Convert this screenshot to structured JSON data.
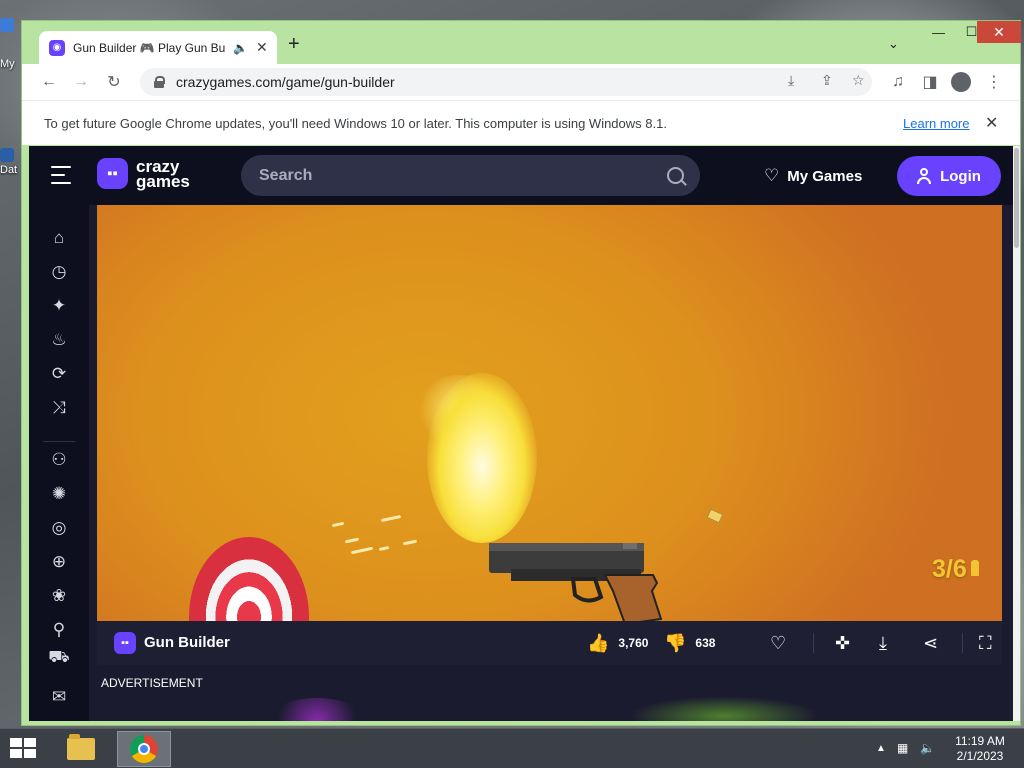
{
  "desktop": {
    "icons": [
      {
        "label": "My"
      },
      {
        "label": "Dat"
      }
    ]
  },
  "browser": {
    "tab": {
      "title": "Gun Builder 🎮 Play Gun Builder on CrazyGames",
      "favicon": "crazygames-logo-icon"
    },
    "new_tab_label": "+",
    "url": "crazygames.com/game/gun-builder",
    "info_bar": {
      "message": "To get future Google Chrome updates, you'll need Windows 10 or later. This computer is using Windows 8.1.",
      "link": "Learn more"
    }
  },
  "site": {
    "logo_text_line1": "crazy",
    "logo_text_line2": "games",
    "search_placeholder": "Search",
    "my_games": "My Games",
    "login": "Login",
    "sidebar_icons": [
      "home-icon",
      "recent-icon",
      "sparkle-icon",
      "fire-icon",
      "refresh-icon",
      "shuffle-icon",
      "multiplayer-icon",
      "action-icon",
      "compass-icon",
      "basketball-icon",
      "flower-icon",
      "bicycle-icon",
      "car-icon",
      "mail-icon"
    ],
    "brand_color": "#6842ff"
  },
  "game": {
    "ammo": "3/6",
    "ammo_current": 3,
    "ammo_max": 6
  },
  "game_bar": {
    "title": "Gun Builder",
    "likes": "3,760",
    "dislikes": "638"
  },
  "ad_label": "ADVERTISEMENT",
  "taskbar": {
    "time": "11:19 AM",
    "date": "2/1/2023"
  }
}
